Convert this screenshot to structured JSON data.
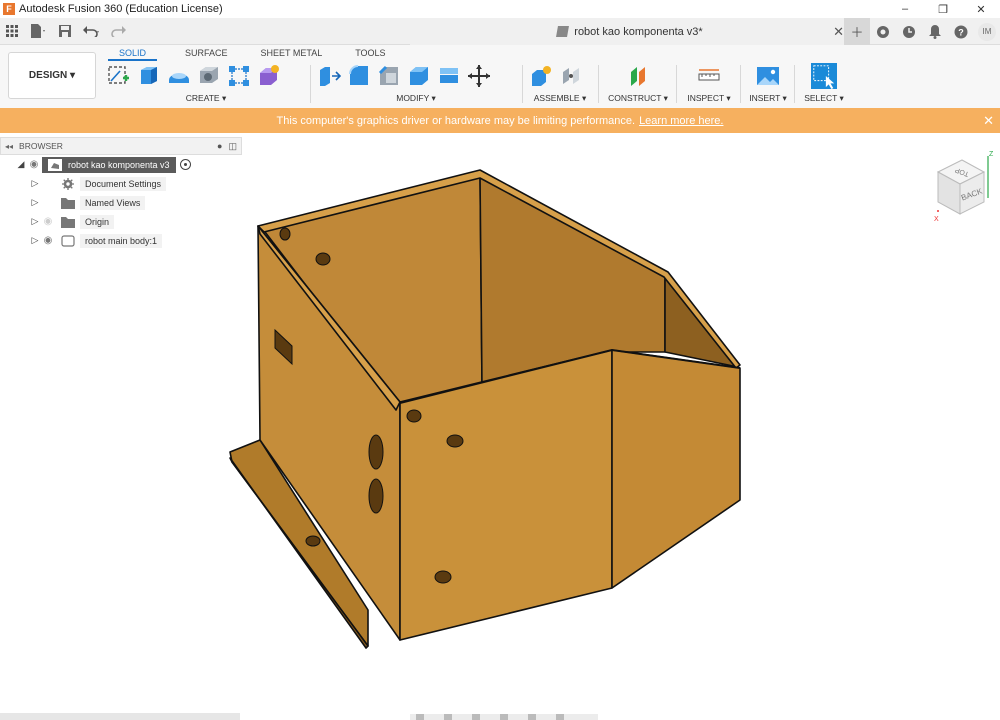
{
  "app": {
    "title": "Autodesk Fusion 360 (Education License)",
    "logo": "F"
  },
  "window_controls": {
    "minimize": "–",
    "restore": "❐",
    "close": "✕"
  },
  "document_tab": {
    "title": "robot kao komponenta v3*",
    "close": "✕"
  },
  "user_initials": "IM",
  "workspace": {
    "label": "DESIGN ▾"
  },
  "ribbon_tabs": [
    {
      "label": "SOLID",
      "active": true
    },
    {
      "label": "SURFACE"
    },
    {
      "label": "SHEET METAL"
    },
    {
      "label": "TOOLS"
    }
  ],
  "groups": {
    "create": "CREATE ▾",
    "modify": "MODIFY ▾",
    "assemble": "ASSEMBLE ▾",
    "construct": "CONSTRUCT ▾",
    "inspect": "INSPECT ▾",
    "insert": "INSERT ▾",
    "select": "SELECT ▾"
  },
  "banner": {
    "text": "This computer's graphics driver or hardware may be limiting performance.",
    "link": "Learn more here."
  },
  "browser": {
    "title": "BROWSER",
    "root": "robot kao komponenta v3",
    "items": [
      {
        "label": "Document Settings",
        "icon": "gear-icon"
      },
      {
        "label": "Named Views",
        "icon": "folder-icon"
      },
      {
        "label": "Origin",
        "icon": "folder-icon",
        "hidden": true
      },
      {
        "label": "robot main body:1",
        "icon": "body-icon"
      }
    ]
  },
  "viewcube": {
    "top": "TOP",
    "back": "BACK",
    "axis_x": "X",
    "axis_z": "Z"
  },
  "colors": {
    "model_face": "#c9913a",
    "banner": "#f6b05f",
    "accent": "#1a73c9"
  }
}
